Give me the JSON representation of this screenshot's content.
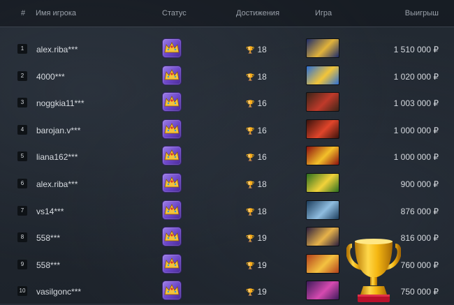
{
  "header": {
    "rank": "#",
    "name": "Имя игрока",
    "status": "Статус",
    "achievements": "Достижения",
    "game": "Игра",
    "winnings": "Выигрыш"
  },
  "rows": [
    {
      "rank": "1",
      "name": "alex.riba***",
      "achievements": "18",
      "game_color": "#1b2a6b",
      "game_accent": "#e2b33a",
      "winnings": "1 510 000 ₽"
    },
    {
      "rank": "2",
      "name": "4000***",
      "achievements": "18",
      "game_color": "#2b6fd6",
      "game_accent": "#f2c53a",
      "winnings": "1 020 000 ₽"
    },
    {
      "rank": "3",
      "name": "noggkia11***",
      "achievements": "16",
      "game_color": "#3b2418",
      "game_accent": "#c03a2a",
      "winnings": "1 003 000 ₽"
    },
    {
      "rank": "4",
      "name": "barojan.v***",
      "achievements": "16",
      "game_color": "#3a120c",
      "game_accent": "#e0452a",
      "winnings": "1 000 000 ₽"
    },
    {
      "rank": "5",
      "name": "liana162***",
      "achievements": "16",
      "game_color": "#8b0f0f",
      "game_accent": "#f3c02a",
      "winnings": "1 000 000 ₽"
    },
    {
      "rank": "6",
      "name": "alex.riba***",
      "achievements": "18",
      "game_color": "#2a6e1f",
      "game_accent": "#f2d23a",
      "winnings": "900 000 ₽"
    },
    {
      "rank": "7",
      "name": "vs14***",
      "achievements": "18",
      "game_color": "#1c3d5c",
      "game_accent": "#8fbde0",
      "winnings": "876 000 ₽"
    },
    {
      "rank": "8",
      "name": "558***",
      "achievements": "19",
      "game_color": "#2b1e3d",
      "game_accent": "#e7b34a",
      "winnings": "816 000 ₽"
    },
    {
      "rank": "9",
      "name": "558***",
      "achievements": "19",
      "game_color": "#b2401c",
      "game_accent": "#f4c240",
      "winnings": "760 000 ₽"
    },
    {
      "rank": "10",
      "name": "vasilgonc***",
      "achievements": "19",
      "game_color": "#3c1a5a",
      "game_accent": "#d64ab0",
      "winnings": "750 000 ₽"
    }
  ],
  "icons": {
    "status": "crown-badge-icon",
    "achievement": "trophy-icon",
    "decor": "golden-trophy-icon"
  },
  "colors": {
    "trophy": "#f1b516",
    "status_badge": "#7a55d6"
  }
}
